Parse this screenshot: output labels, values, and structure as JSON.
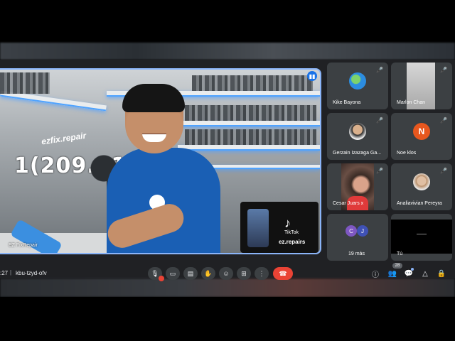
{
  "main_speaker": {
    "name": "EZ FixRepair",
    "wall_text": "1(209.316",
    "wall_text_top": "ezfix.repair",
    "tiktok_brand": "TikTok",
    "tiktok_url": "ez.repairs"
  },
  "participants": [
    {
      "name": "Kike Bayona"
    },
    {
      "name": "Marlon Chan"
    },
    {
      "name": "Gerzain Izazaga Ga..."
    },
    {
      "name": "Noe klos",
      "initial": "N"
    },
    {
      "name": "Cesar Juars x"
    },
    {
      "name": "Analiavivian Pereyra"
    },
    {
      "name": "19 más",
      "initials": [
        "C",
        "J"
      ]
    },
    {
      "name": "Tú"
    }
  ],
  "meeting": {
    "time": ":27",
    "separator": "|",
    "code": "kbu-tzyd-ofv",
    "participant_count": "28"
  },
  "icons": {
    "mic": "🎙",
    "camera": "▭",
    "captions": "▤",
    "hand": "✋",
    "emoji": "☺",
    "present": "⊞",
    "more": "⋮",
    "end": "☎",
    "info": "ⓘ",
    "people": "👥",
    "chat": "💬",
    "activities": "△",
    "lock": "🔒",
    "mute": "🎤",
    "speaking": "▮▮",
    "tiktok": "♪"
  }
}
